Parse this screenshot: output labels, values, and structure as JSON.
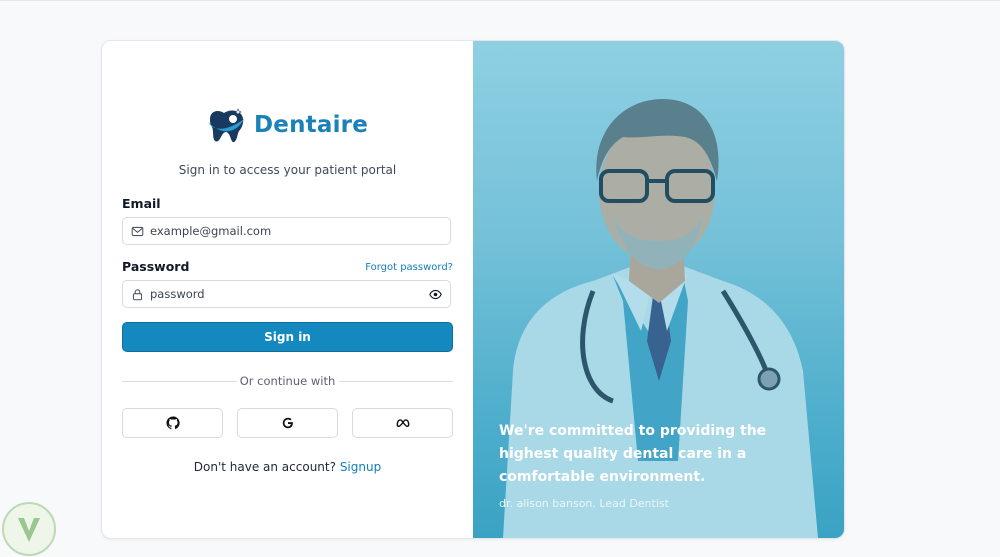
{
  "brand": {
    "name": "Dentaire"
  },
  "login": {
    "subtitle": "Sign in to access your patient portal",
    "email_label": "Email",
    "email_placeholder": "example@gmail.com",
    "password_label": "Password",
    "forgot_label": "Forgot password?",
    "password_placeholder": "password",
    "signin_label": "Sign in",
    "divider_text": "Or continue with",
    "social": [
      {
        "name": "github",
        "icon": "github-icon"
      },
      {
        "name": "google",
        "icon": "google-icon"
      },
      {
        "name": "meta",
        "icon": "meta-icon"
      }
    ],
    "signup_prompt": "Don't have an account?",
    "signup_link": "Signup"
  },
  "hero": {
    "quote": "We're committed to providing the highest quality dental care in a comfortable environment.",
    "author": "dr. alison banson, Lead Dentist"
  },
  "colors": {
    "accent": "#1489bf",
    "brand": "#1a82b8",
    "hero_overlay": "#5bb4cf"
  }
}
